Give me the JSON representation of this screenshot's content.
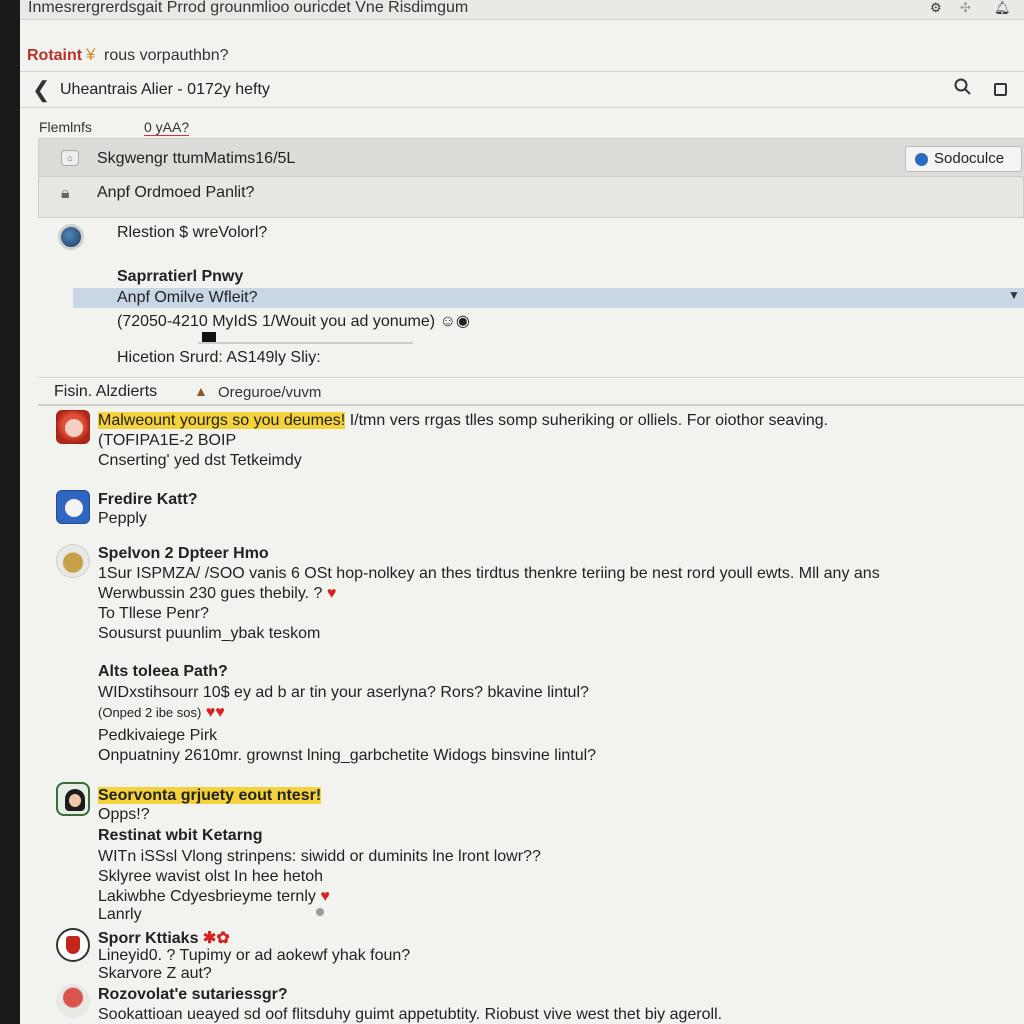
{
  "window": {
    "title": "Inmesrergrerdsgait Prrod grounmlioo ouricdet Vne Risdimgum",
    "icons": [
      "gear-icon",
      "puzzle-icon",
      "bell-icon"
    ]
  },
  "app": {
    "brand": "Rotaint",
    "brand_icon": "y-icon",
    "subtitle": "rous vorpauthbn?"
  },
  "nav": {
    "back": "❮",
    "title": "Uheantrais Alier  -  0172y hefty",
    "search_icon": "⌕"
  },
  "filter": {
    "label": "Flemlnfs",
    "value": "0 yAA?"
  },
  "panel": {
    "row1_text": "Skgwengr ttumMatims16/5L",
    "button_label": "Sodoculce",
    "row2_text": "Anpf Ordmoed Panlit?"
  },
  "section2": {
    "title": "Rlestion $ wreVolorl?",
    "subtitle": "Saprratierl Pnwy",
    "highlighted": "Anpf Omilve Wfleit?",
    "detail": "(72050-4210 MyIdS 1/Wouit you ad yonume)",
    "footer": "Hicetion Srurd: AS149ly Sliy:"
  },
  "sortbar": {
    "label": "Fisin. Alzdierts",
    "value": "Oreguroe/vuvm"
  },
  "feed": [
    {
      "avatar": "red-avatar",
      "highlight": "Malweount yourgs so you deumes!",
      "line1_rest": " I/tmn vers rrgas tlles somp suheriking or olliels.  For oiothor seaving.",
      "line2": "(TOFIPA1E-2 BOIP",
      "line3": "Cnserting' yed dst Tetkeimdy"
    },
    {
      "avatar": "blue-avatar",
      "name": "Fredire Katt?",
      "line2": "Pepply"
    },
    {
      "avatar": "gold-avatar",
      "name": "Spelvon 2  Dpteer Hmo",
      "line2": "1Sur ISPMZA/ /SOO vanis 6 OSt hop-nolkey an thes tirdtus thenkre teriing be nest rord youll ewts. Mll any ans",
      "line3": "Werwbussin 230 gues thebily.  ?",
      "line4": "To Tllese Penr?",
      "line5": "Sousurst puunlim_ybak  teskom"
    },
    {
      "name": "Alts toleea Path?",
      "line2": "WIDxstihsourr  10$ ey ad b ar tin your aserlyna? Rors? bkavine lintul?",
      "line3": "(Onped 2 ibe sos)",
      "line4": "Pedkivaiege Pirk",
      "line5": "Onpuatniny 2610mr. grownst lning_garbchetite Widogs binsvine lintul?"
    },
    {
      "avatar": "girl-avatar",
      "highlight": "Seorvonta grjuety eout ntesr!",
      "line2": "Opps!?",
      "line3": "Restinat wbit Ketarng",
      "line4": "WITn iSSsl Vlong strinpens: siwidd or duminits lne lront lowr??",
      "line5": "Sklyree wavist olst In hee hetoh",
      "line6": "Lakiwbhe Cdyesbrieyme ternly",
      "line7": "Lanrly"
    },
    {
      "avatar": "badge-avatar",
      "name": "Sporr Kttiaks",
      "line2": "Lineyid0. ? Tupimy or ad aokewf yhak foun?",
      "line3": "Skarvore Z aut?"
    },
    {
      "avatar": "rose-avatar",
      "name": "Rozovolat'e sutariessgr?",
      "line2": "Sookattioan ueayed sd oof flitsduhy guimt appetubtity. Riobust vive west thet biy ageroll."
    }
  ],
  "colors": {
    "brand": "#b5322a",
    "highlight": "#f3d23c",
    "selection": "#c8d6e6",
    "heart": "#d42323"
  }
}
